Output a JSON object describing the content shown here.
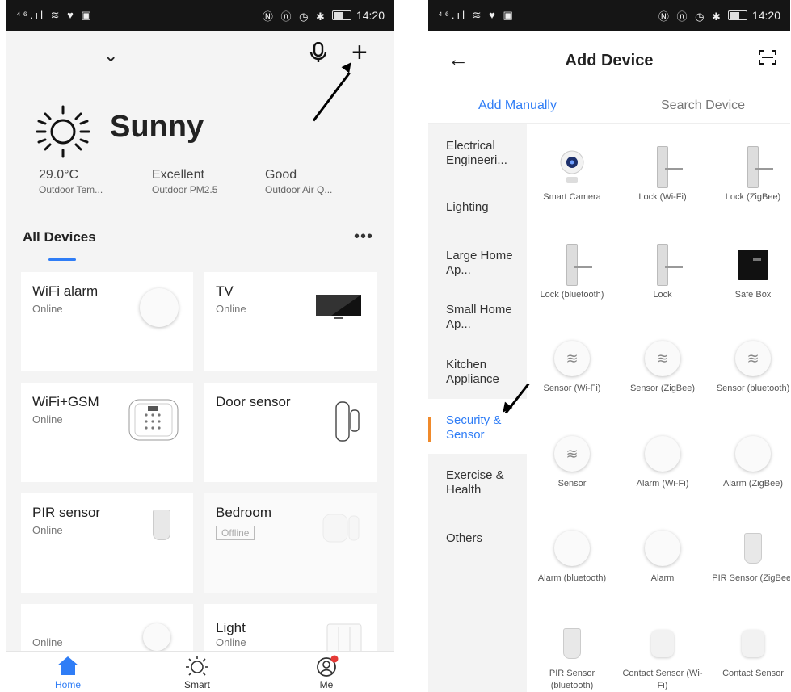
{
  "left": {
    "status": {
      "signal": "⁴⁶.ıl ≋ ♥ ▣",
      "icons": "Ⓝ ⓝ ◷ ✱",
      "time": "14:20"
    },
    "weather": {
      "condition": "Sunny"
    },
    "stats": [
      {
        "value": "29.0°C",
        "label": "Outdoor Tem..."
      },
      {
        "value": "Excellent",
        "label": "Outdoor PM2.5"
      },
      {
        "value": "Good",
        "label": "Outdoor Air Q..."
      }
    ],
    "section_title": "All Devices",
    "more": "•••",
    "devices": [
      {
        "name": "WiFi alarm",
        "status": "Online"
      },
      {
        "name": "TV",
        "status": "Online"
      },
      {
        "name": "WiFi+GSM",
        "status": "Online"
      },
      {
        "name": "Door sensor",
        "status": ""
      },
      {
        "name": "PIR sensor",
        "status": "Online"
      },
      {
        "name": "Bedroom",
        "status": "Offline"
      },
      {
        "name": "",
        "status": "Online"
      },
      {
        "name": "Light",
        "status": "Online"
      }
    ],
    "tabs": [
      {
        "label": "Home"
      },
      {
        "label": "Smart"
      },
      {
        "label": "Me"
      }
    ]
  },
  "right": {
    "status": {
      "signal": "⁴⁶.ıl ≋ ♥ ▣",
      "icons": "Ⓝ ⓝ ◷ ✱",
      "time": "14:20"
    },
    "title": "Add Device",
    "tabs": {
      "manual": "Add Manually",
      "search": "Search Device"
    },
    "categories": [
      "Electrical Engineeri...",
      "Lighting",
      "Large Home Ap...",
      "Small Home Ap...",
      "Kitchen Appliance",
      "Security & Sensor",
      "Exercise & Health",
      "Others"
    ],
    "devices": [
      "Smart Camera",
      "Lock (Wi-Fi)",
      "Lock (ZigBee)",
      "Lock (bluetooth)",
      "Lock",
      "Safe Box",
      "Sensor (Wi-Fi)",
      "Sensor (ZigBee)",
      "Sensor (bluetooth)",
      "Sensor",
      "Alarm (Wi-Fi)",
      "Alarm (ZigBee)",
      "Alarm (bluetooth)",
      "Alarm",
      "PIR Sensor (ZigBee)",
      "PIR Sensor (bluetooth)",
      "Contact Sensor (Wi-Fi)",
      "Contact Sensor"
    ]
  },
  "colors": {
    "accent": "#2f7df6",
    "selected_bar": "#f08a2b",
    "status_bar": "#151515"
  }
}
